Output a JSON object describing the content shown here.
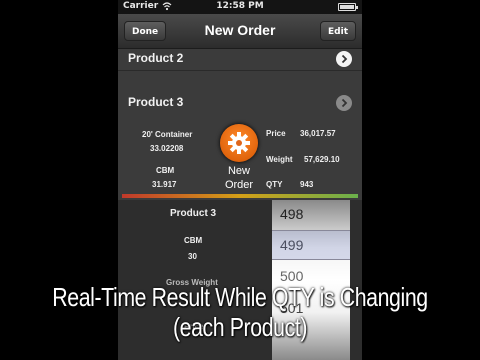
{
  "status_bar": {
    "carrier": "Carrier",
    "time": "12:58 PM"
  },
  "nav": {
    "title": "New Order",
    "left_button": "Done",
    "right_button": "Edit"
  },
  "rows": [
    {
      "label": "Product 2",
      "icon": "chevron-right-icon"
    },
    {
      "label": "Product 3",
      "icon": "chevron-right-icon"
    }
  ],
  "details": {
    "container_label": "20' Container",
    "container_value": "33.02208",
    "cbm_label": "CBM",
    "cbm_value": "31.917",
    "price_label": "Price",
    "price_value": "36,017.57",
    "weight_label": "Weight",
    "weight_value": "57,629.10",
    "qty_label": "QTY",
    "qty_value": "943",
    "action_line1": "New",
    "action_line2": "Order"
  },
  "lower": {
    "product": "Product 3",
    "cbm_label": "CBM",
    "cbm_value": "30",
    "gross_label": "Gross Weight",
    "price_label": "Price"
  },
  "picker": {
    "values": [
      "498",
      "499",
      "500",
      "501"
    ]
  },
  "caption": {
    "line1": "Real-Time Result While QTY is Changing",
    "line2": "(each Product)"
  },
  "colors": {
    "accent_orange": "#e8751a",
    "background": "#3b3b3b"
  }
}
